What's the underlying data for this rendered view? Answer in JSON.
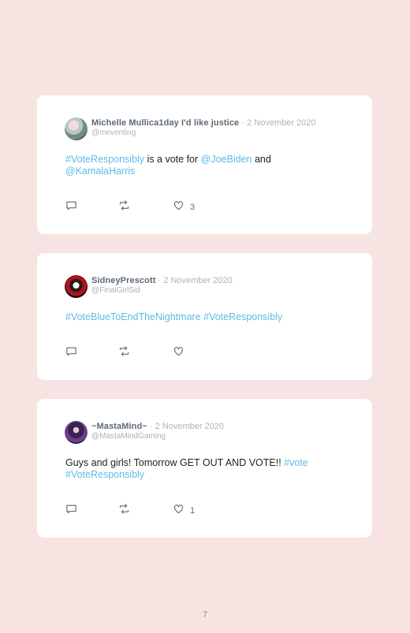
{
  "tweets": [
    {
      "name": "Michelle Mullica1day I'd like justice",
      "date": "2 November 2020",
      "handle": "@meventing",
      "body": [
        {
          "text": "#VoteResponsibly",
          "link": true
        },
        {
          "text": " is a vote for ",
          "link": false
        },
        {
          "text": "@JoeBiden",
          "link": true
        },
        {
          "text": " and ",
          "link": false
        },
        {
          "text": "@KamalaHarris",
          "link": true
        }
      ],
      "like_count": "3",
      "avatar_icon": "profile-photo-avatar"
    },
    {
      "name": "SidneyPrescott",
      "date": "2 November 2020",
      "handle": "@FinalGirlSid",
      "body": [
        {
          "text": "#VoteBlueToEndTheNightmare",
          "link": true
        },
        {
          "text": " ",
          "link": false
        },
        {
          "text": "#VoteResponsibly",
          "link": true
        }
      ],
      "like_count": "",
      "avatar_icon": "profile-photo-avatar"
    },
    {
      "name": "~MastaMind~",
      "date": "2 November 2020",
      "handle": "@MastaMindGaming",
      "body": [
        {
          "text": "Guys and girls! Tomorrow GET OUT AND VOTE!! ",
          "link": false
        },
        {
          "text": "#vote",
          "link": true
        },
        {
          "text": " ",
          "link": false
        },
        {
          "text": "#VoteResponsibly",
          "link": true
        }
      ],
      "like_count": "1",
      "avatar_icon": "profile-photo-avatar"
    }
  ],
  "separator": "·",
  "page_number": "7",
  "icons": {
    "reply": "reply-icon",
    "retweet": "retweet-icon",
    "like": "heart-icon"
  },
  "colors": {
    "background": "#f6e3e2",
    "card": "#ffffff",
    "link": "#5dbbe6",
    "name": "#5c6a76",
    "muted": "#a8b3bd"
  }
}
